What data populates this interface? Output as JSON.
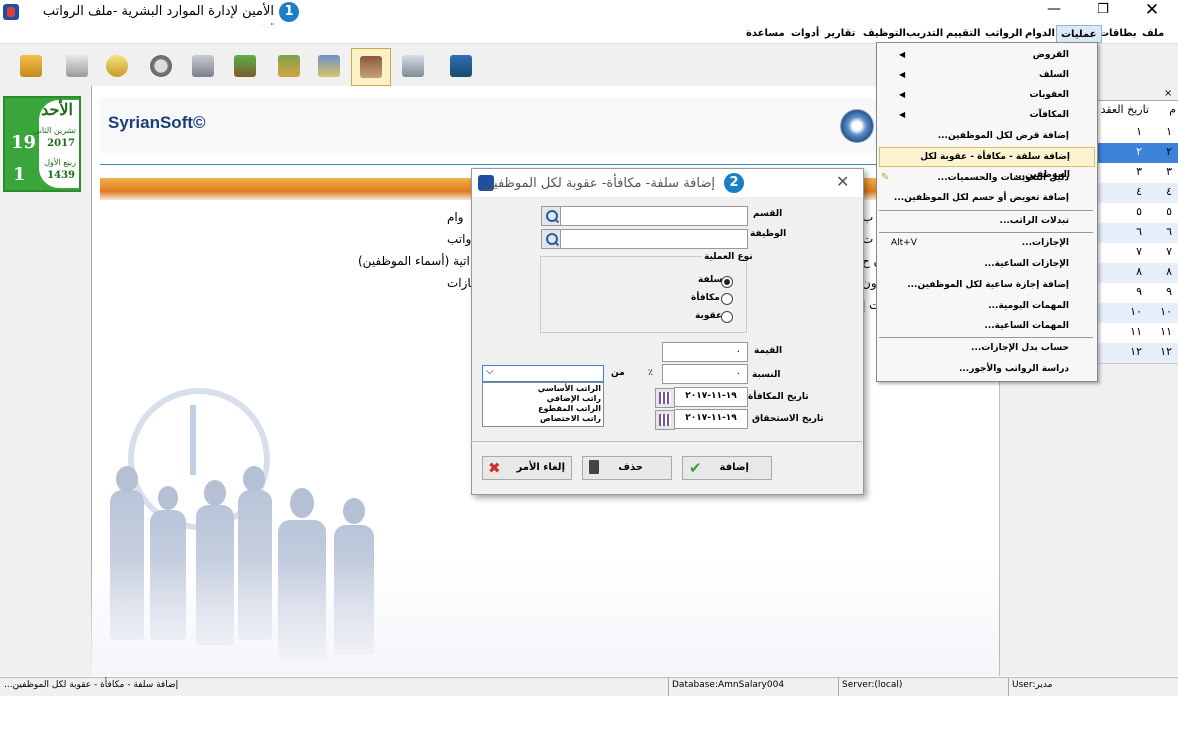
{
  "window": {
    "title": "الأمين لإدارة الموارد البشرية -ملف الرواتب تجريبي",
    "step1": "1",
    "minimize": "—",
    "maximize": "❐",
    "close": "✕"
  },
  "menubar": {
    "items": [
      "ملف",
      "بطاقات",
      "عمليات",
      "الدوام",
      "الرواتب",
      "التقييم",
      "التدريب",
      "التوظيف",
      "تقارير",
      "أدوات",
      "مساعدة"
    ],
    "active": "عمليات"
  },
  "toolbar": {
    "tools": [
      "folder-arrow-icon",
      "id-card-icon",
      "add-user-icon",
      "clock-icon",
      "monitor-clock-icon",
      "money-tree-icon",
      "books-icon",
      "book-person-icon",
      "employees-icon",
      "calculator-icon",
      "exit-door-icon"
    ],
    "selected": "employees-icon"
  },
  "date_widget": {
    "day": "الأحد",
    "greg_month": "تشرين الثاني",
    "greg_day": "19",
    "greg_year": "2017",
    "hijri_month": "ربيع الأول",
    "hijri_day": "1",
    "hijri_year": "1439"
  },
  "brand": {
    "name": "SyrianSoft©"
  },
  "background_text": {
    "line1": "وام",
    "line2": "واتب",
    "line3": "اتية (أسماء الموظفين)",
    "line4": "جازات",
    "frag1": "ن ب",
    "frag2": "ن ت",
    "frag3": "ن ح",
    "frag4": "ون",
    "frag5": "ت إ"
  },
  "grid": {
    "col_num": "م",
    "col_date": "تاريخ العقد",
    "close": "×",
    "rows": [
      {
        "n": "١",
        "v": "١"
      },
      {
        "n": "٢",
        "v": "٢"
      },
      {
        "n": "٣",
        "v": "٣"
      },
      {
        "n": "٤",
        "v": "٤"
      },
      {
        "n": "٥",
        "v": "٥"
      },
      {
        "n": "٦",
        "v": "٦"
      },
      {
        "n": "٧",
        "v": "٧"
      },
      {
        "n": "٨",
        "v": "٨"
      },
      {
        "n": "٩",
        "v": "٩"
      },
      {
        "n": "١٠",
        "v": "١٠"
      },
      {
        "n": "١١",
        "v": "١١"
      },
      {
        "n": "١٢",
        "v": "١٢"
      }
    ]
  },
  "ops_menu": {
    "items": [
      {
        "label": "القروض",
        "submenu": true
      },
      {
        "label": "السلف",
        "submenu": true
      },
      {
        "label": "العقوبات",
        "submenu": true
      },
      {
        "label": "المكافآت",
        "submenu": true
      },
      {
        "label": "إضافة قرض لكل الموظفين..."
      },
      {
        "label": "إضافة سلفة - مكافأة - عقوبة لكل الموظفين...",
        "highlighted": true
      },
      {
        "label": "دليل التعويضات والحسميات..."
      },
      {
        "label": "إضافة تعويض أو حسم لكل الموظفين..."
      },
      {
        "label": "تبدلات الراتب..."
      },
      {
        "label": "الإجازات...",
        "shortcut": "Alt+V"
      },
      {
        "label": "الإجازات الساعية..."
      },
      {
        "label": "إضافة إجازة ساعية لكل الموظفين..."
      },
      {
        "label": "المهمات اليومية..."
      },
      {
        "label": "المهمات الساعية..."
      },
      {
        "label": "حساب بدل الإجازات..."
      },
      {
        "label": "دراسة الرواتب والأجور..."
      }
    ]
  },
  "dialog": {
    "title": "إضافة سلفة- مكافأة- عقوبة لكل الموظفين",
    "step2": "2",
    "close": "✕",
    "dept_label": "القسم",
    "job_label": "الوظيفة",
    "dept_value": "",
    "job_value": "",
    "op_type_label": "نوع العملية",
    "op_options": [
      "سلفة",
      "مكافأة",
      "عقوبة"
    ],
    "op_selected": "سلفة",
    "value_label": "القيمة",
    "value": "٠",
    "ratio_label": "النسبة",
    "ratio": "٠",
    "percent_sign": "٪",
    "from_label": "من",
    "salary_options": [
      "الراتب الأساسي",
      "راتب الإضافي",
      "الراتب المقطوع",
      "راتب الاختصاص"
    ],
    "reward_date_label": "تاريخ المكافأة",
    "reward_date": "١٩-١١-٢٠١٧",
    "due_date_label": "تاريخ الاستحقاق",
    "due_date": "١٩-١١-٢٠١٧",
    "add_button": "إضافة",
    "delete_button": "حذف",
    "cancel_button": "إلغاء الأمر"
  },
  "statusbar": {
    "left": "إضافة سلفة - مكافأة - عقوبة لكل الموظفين...",
    "database": "Database:AmnSalary004",
    "server": "Server:(local)",
    "user": "User:مدير"
  },
  "colors": {
    "accent": "#1a7fc4",
    "menu_highlight": "#fdf3cf",
    "grid_selected": "#3d82d9",
    "date_widget": "#3aa53a"
  }
}
